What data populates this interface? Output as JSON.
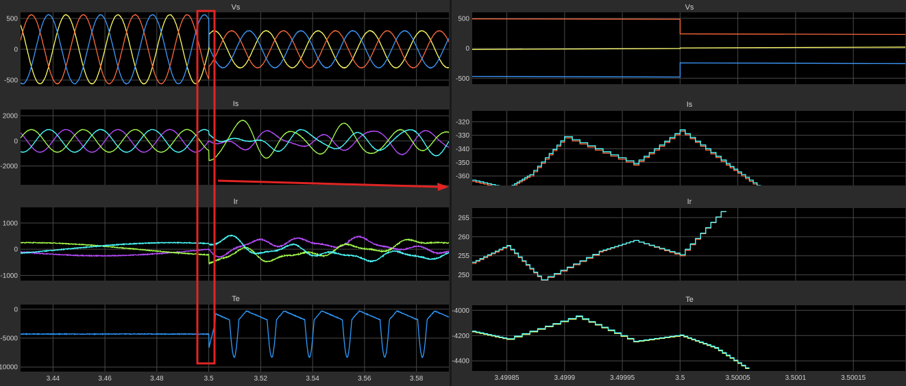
{
  "chart_data": [
    {
      "type": "line",
      "title": "Vs",
      "xlim": [
        3.4275,
        3.5925
      ],
      "ylim": [
        -600,
        600
      ],
      "x_ticks": [],
      "y_ticks": [
        {
          "value": 500,
          "label": "500"
        },
        {
          "value": 0,
          "label": "0"
        },
        {
          "value": -500,
          "label": "-500"
        }
      ],
      "series": [
        {
          "color": "#ffff66"
        },
        {
          "color": "#ff6a3d"
        },
        {
          "color": "#3d9bff"
        }
      ],
      "signal": {
        "kind": "three_phase",
        "freq_hz": 50,
        "amp_pre": 560,
        "amp_post": 300,
        "t_fault": 3.5
      }
    },
    {
      "type": "line",
      "title": "Is",
      "xlim": [
        3.4275,
        3.5925
      ],
      "ylim": [
        -3500,
        2500
      ],
      "x_ticks": [],
      "y_ticks": [
        {
          "value": 2000,
          "label": "2000"
        },
        {
          "value": 0,
          "label": "0"
        },
        {
          "value": -2000,
          "label": "-2000"
        }
      ],
      "series": [
        {
          "color": "#b84dff"
        },
        {
          "color": "#a6ff4d"
        },
        {
          "color": "#4dffff"
        }
      ],
      "signal": {
        "kind": "three_phase_disturbed",
        "freq_hz": 50,
        "amp_pre": 900,
        "amp_post": 800,
        "t_fault": 3.5
      }
    },
    {
      "type": "line",
      "title": "Ir",
      "xlim": [
        3.4275,
        3.5925
      ],
      "ylim": [
        -1200,
        1600
      ],
      "x_ticks": [],
      "y_ticks": [
        {
          "value": 1000,
          "label": "1000"
        },
        {
          "value": 0,
          "label": "0"
        },
        {
          "value": -1000,
          "label": "-1000"
        }
      ],
      "series": [
        {
          "color": "#b84dff"
        },
        {
          "color": "#a6ff4d"
        },
        {
          "color": "#4dffff"
        }
      ],
      "signal": {
        "kind": "three_phase_disturbed",
        "freq_hz": 6,
        "amp_pre": 250,
        "amp_post": 280,
        "t_fault": 3.5
      }
    },
    {
      "type": "line",
      "title": "Te",
      "xlim": [
        3.4275,
        3.5925
      ],
      "ylim": [
        -10800,
        800
      ],
      "x_ticks": [
        {
          "value": 3.44,
          "label": "3.44"
        },
        {
          "value": 3.46,
          "label": "3.46"
        },
        {
          "value": 3.48,
          "label": "3.48"
        },
        {
          "value": 3.5,
          "label": "3.5"
        },
        {
          "value": 3.52,
          "label": "3.52"
        },
        {
          "value": 3.54,
          "label": "3.54"
        },
        {
          "value": 3.56,
          "label": "3.56"
        },
        {
          "value": 3.58,
          "label": "3.58"
        }
      ],
      "y_ticks": [
        {
          "value": 0,
          "label": "0"
        },
        {
          "value": -5000,
          "label": "-5000"
        },
        {
          "value": -10000,
          "label": "-10000"
        }
      ],
      "series": [
        {
          "color": "#2f9bff"
        }
      ],
      "signal": {
        "kind": "torque",
        "level_pre": -4300,
        "t_fault": 3.5
      }
    },
    {
      "type": "line",
      "title": "Vs",
      "xlim": [
        3.49982,
        3.500195
      ],
      "ylim": [
        -600,
        600
      ],
      "x_ticks": [],
      "y_ticks": [
        {
          "value": 500,
          "label": "500"
        },
        {
          "value": 0,
          "label": "0"
        },
        {
          "value": -500,
          "label": "-500"
        }
      ],
      "series": [
        {
          "color": "#ff6a3d",
          "x": [
            3.49982,
            3.5,
            3.5,
            3.500195
          ],
          "y": [
            490,
            485,
            240,
            230
          ]
        },
        {
          "color": "#ffff66",
          "x": [
            3.49982,
            3.5,
            3.5,
            3.500195
          ],
          "y": [
            -20,
            -5,
            5,
            20
          ]
        },
        {
          "color": "#3d9bff",
          "x": [
            3.49982,
            3.5,
            3.5,
            3.500195
          ],
          "y": [
            -470,
            -480,
            -245,
            -255
          ]
        }
      ]
    },
    {
      "type": "line",
      "title": "Is",
      "xlim": [
        3.49982,
        3.500195
      ],
      "ylim": [
        -367,
        -312
      ],
      "x_ticks": [],
      "y_ticks": [
        {
          "value": -320,
          "label": "-320"
        },
        {
          "value": -330,
          "label": "-330"
        },
        {
          "value": -340,
          "label": "-340"
        },
        {
          "value": -350,
          "label": "-350"
        },
        {
          "value": -360,
          "label": "-360"
        }
      ],
      "series": [
        {
          "color": "#ff6a3d",
          "step": true,
          "x": [
            3.49982,
            3.49985,
            3.49987,
            3.4999,
            3.49996,
            3.5,
            3.50004,
            3.50007
          ],
          "y": [
            -364,
            -370,
            -360,
            -332,
            -352,
            -327,
            -352,
            -370
          ]
        },
        {
          "color": "#4dffff",
          "step": true,
          "x": [
            3.49982,
            3.49985,
            3.49987,
            3.4999,
            3.49996,
            3.5,
            3.50004,
            3.50007
          ],
          "y": [
            -363,
            -369,
            -359,
            -331,
            -351,
            -326,
            -351,
            -369
          ]
        }
      ]
    },
    {
      "type": "line",
      "title": "Ir",
      "xlim": [
        3.49982,
        3.500195
      ],
      "ylim": [
        248.5,
        267.5
      ],
      "x_ticks": [],
      "y_ticks": [
        {
          "value": 265,
          "label": "265"
        },
        {
          "value": 260,
          "label": "260"
        },
        {
          "value": 255,
          "label": "255"
        },
        {
          "value": 250,
          "label": "250"
        }
      ],
      "series": [
        {
          "color": "#ff6a3d",
          "step": true,
          "x": [
            3.49982,
            3.49985,
            3.49988,
            3.49993,
            3.49996,
            3.5,
            3.50004
          ],
          "y": [
            253,
            257.5,
            248.5,
            256,
            259,
            255,
            268
          ]
        },
        {
          "color": "#4dffff",
          "step": true,
          "x": [
            3.49982,
            3.49985,
            3.49988,
            3.49993,
            3.49996,
            3.5,
            3.50004
          ],
          "y": [
            253.3,
            257.7,
            248.7,
            256.2,
            259,
            255.3,
            268
          ]
        }
      ]
    },
    {
      "type": "line",
      "title": "Te",
      "xlim": [
        3.49982,
        3.500195
      ],
      "ylim": [
        -4480,
        -3960
      ],
      "x_ticks": [
        {
          "value": 3.49985,
          "label": "3.49985"
        },
        {
          "value": 3.4999,
          "label": "3.4999"
        },
        {
          "value": 3.49995,
          "label": "3.49995"
        },
        {
          "value": 3.5,
          "label": "3.5"
        },
        {
          "value": 3.50005,
          "label": "3.50005"
        },
        {
          "value": 3.5001,
          "label": "3.5001"
        },
        {
          "value": 3.50015,
          "label": "3.50015"
        }
      ],
      "y_ticks": [
        {
          "value": -4000,
          "label": "-4000"
        },
        {
          "value": -4200,
          "label": "-4200"
        },
        {
          "value": -4400,
          "label": "-4400"
        }
      ],
      "series": [
        {
          "color": "#ffff66",
          "step": true,
          "x": [
            3.49982,
            3.49985,
            3.49991,
            3.49996,
            3.5,
            3.50003,
            3.50006
          ],
          "y": [
            -4170,
            -4230,
            -4050,
            -4250,
            -4200,
            -4300,
            -4480
          ]
        },
        {
          "color": "#4dffff",
          "step": true,
          "x": [
            3.49982,
            3.49985,
            3.49991,
            3.49996,
            3.5,
            3.50003,
            3.50006
          ],
          "y": [
            -4165,
            -4225,
            -4045,
            -4245,
            -4195,
            -4295,
            -4475
          ]
        }
      ]
    }
  ],
  "annotation": {
    "highlight_color": "#e02424",
    "zoom_x_start": 3.4975,
    "zoom_x_end": 3.5005
  }
}
